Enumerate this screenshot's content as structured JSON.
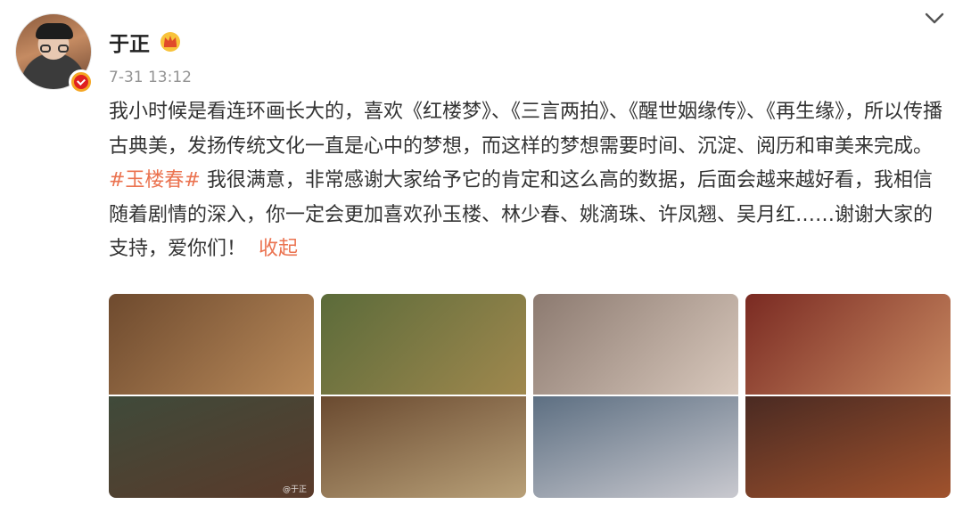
{
  "user": {
    "name": "于正",
    "timestamp": "7-31 13:12"
  },
  "icons": {
    "avatar": "avatar",
    "verified": "verified-badge-icon",
    "crown": "crown-icon",
    "menu": "chevron-down-icon"
  },
  "post": {
    "segments": [
      {
        "type": "text",
        "text": "我小时候是看连环画长大的，喜欢《红楼梦》、《三言两拍》、《醒世姻缘传》、《再生缘》，所以传播古典美，发扬传统文化一直是心中的梦想，而这样的梦想需要时间、沉淀、阅历和审美来完成。"
      },
      {
        "type": "hashtag",
        "text": "#玉楼春#"
      },
      {
        "type": "text",
        "text": " 我很满意，非常感谢大家给予它的肯定和这么高的数据，后面会越来越好看，我相信随着剧情的深入，你一定会更加喜欢孙玉楼、林少春、姚滴珠、许凤翘、吴月红……谢谢大家的支持，爱你们！"
      }
    ],
    "collapse_label": "收起"
  },
  "photos": [
    {
      "label": "drama-still-1",
      "watermark": "@于正",
      "colors": [
        "#6e4a2e",
        "#b98a5a",
        "#3f4a3a",
        "#5a3a2a"
      ]
    },
    {
      "label": "drama-still-2",
      "watermark": "",
      "colors": [
        "#5b6b3a",
        "#a0884e",
        "#6a4a30",
        "#b8a078"
      ]
    },
    {
      "label": "drama-still-3",
      "watermark": "",
      "colors": [
        "#8c7a70",
        "#d8c8bc",
        "#5d6f82",
        "#c9c9cf"
      ]
    },
    {
      "label": "drama-still-4",
      "watermark": "",
      "colors": [
        "#7a2a22",
        "#c98a62",
        "#4a2a22",
        "#a0522d"
      ]
    }
  ],
  "colors": {
    "accent": "#eb7350",
    "muted": "#939393"
  }
}
